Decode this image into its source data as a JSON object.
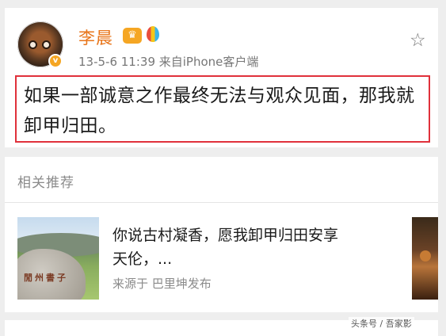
{
  "post": {
    "username": "李晨",
    "badges": [
      "crown-badge",
      "balloon-badge"
    ],
    "verified_icon": "v",
    "meta": "13-5-6 11:39  来自iPhone客户端",
    "text": "如果一部诚意之作最终无法与观众见面，那我就卸甲归田。",
    "highlight_color": "#e0313b",
    "username_color": "#e8751a"
  },
  "related": {
    "title": "相关推荐",
    "item": {
      "text": "你说古村凝香，愿我卸甲归田安享天伦，...",
      "source": "来源于 巴里坤发布",
      "thumbnail_caption": "閒州書子"
    }
  },
  "watermark": "头条号 / 吾家影"
}
